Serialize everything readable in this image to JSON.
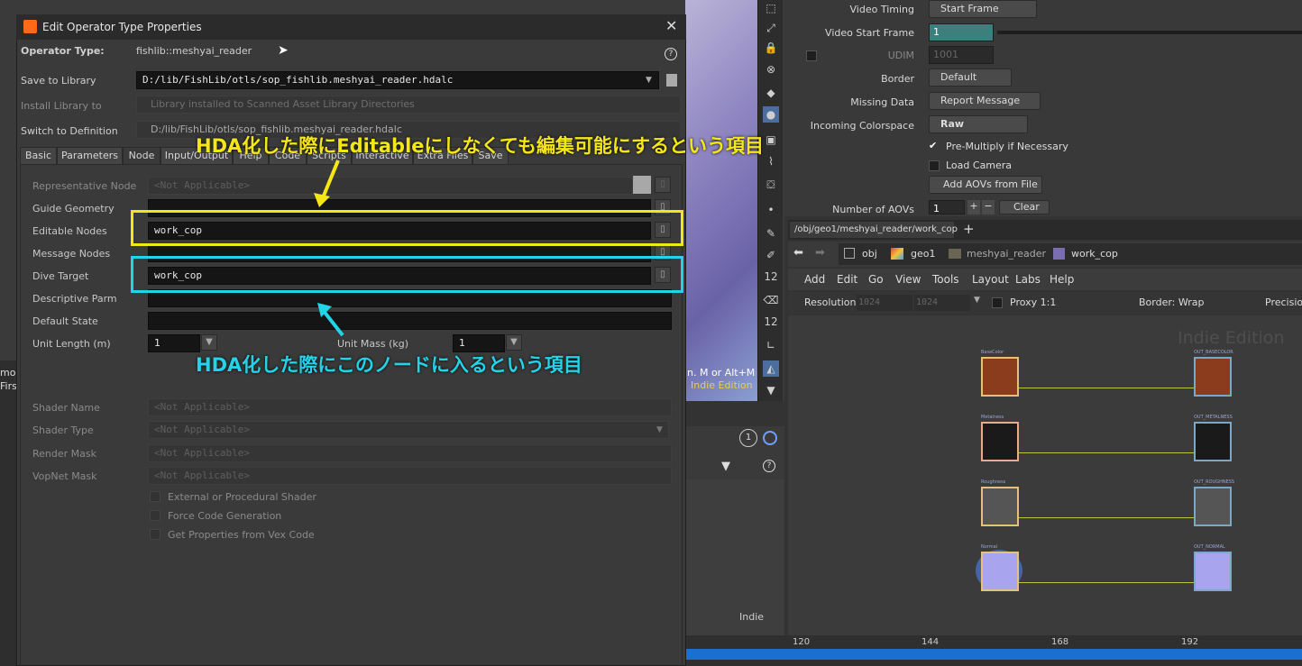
{
  "dialog": {
    "title": "Edit Operator Type Properties",
    "operator_type_label": "Operator Type:",
    "operator_type_value": "fishlib::meshyai_reader",
    "save_to_library_label": "Save to Library",
    "save_to_library_value": "D:/lib/FishLib/otls/sop_fishlib.meshyai_reader.hdalc",
    "install_library_label": "Install Library to",
    "install_library_value": "Library installed to Scanned Asset Library Directories",
    "switch_definition_label": "Switch to Definition",
    "switch_definition_value": "D:/lib/FishLib/otls/sop_fishlib.meshyai_reader.hdalc",
    "tabs": [
      "Basic",
      "Parameters",
      "Node",
      "Input/Output",
      "Help",
      "Code",
      "Scripts",
      "Interactive",
      "Extra Files",
      "Save"
    ],
    "node_tab": {
      "representative_node_label": "Representative Node",
      "representative_node_value": "<Not Applicable>",
      "guide_geometry_label": "Guide Geometry",
      "editable_nodes_label": "Editable Nodes",
      "editable_nodes_value": "work_cop",
      "message_nodes_label": "Message Nodes",
      "dive_target_label": "Dive Target",
      "dive_target_value": "work_cop",
      "descriptive_parm_label": "Descriptive Parm",
      "default_state_label": "Default State",
      "unit_length_label": "Unit Length (m)",
      "unit_length_value": "1",
      "unit_mass_label": "Unit Mass (kg)",
      "unit_mass_value": "1",
      "shader_name_label": "Shader Name",
      "shader_name_value": "<Not Applicable>",
      "shader_type_label": "Shader Type",
      "shader_type_value": "<Not Applicable>",
      "render_mask_label": "Render Mask",
      "render_mask_value": "<Not Applicable>",
      "vopnet_mask_label": "VopNet Mask",
      "vopnet_mask_value": "<Not Applicable>",
      "external_shader_label": "External or Procedural Shader",
      "force_code_label": "Force Code Generation",
      "get_properties_label": "Get Properties from Vex Code"
    }
  },
  "annotations": {
    "editable_text": "HDA化した際にEditableにしなくても編集可能にするという項目",
    "editable_color": "#f5e616",
    "dive_text": "HDA化した際にこのノードに入るという項目",
    "dive_color": "#23d3e8"
  },
  "params": {
    "video_timing_label": "Video Timing",
    "video_timing_value": "Start Frame",
    "video_start_frame_label": "Video Start Frame",
    "video_start_frame_value": "1",
    "udim_label": "UDIM",
    "udim_value": "1001",
    "border_label": "Border",
    "border_value": "Default",
    "missing_data_label": "Missing Data",
    "missing_data_value": "Report Message",
    "incoming_colorspace_label": "Incoming Colorspace",
    "incoming_colorspace_value": "Raw",
    "premultiply_label": "Pre-Multiply if Necessary",
    "load_camera_label": "Load Camera",
    "add_aovs_label": "Add AOVs from File",
    "number_of_aovs_label": "Number of AOVs",
    "number_of_aovs_value": "1",
    "clear_label": "Clear"
  },
  "network": {
    "tab_path": "/obj/geo1/meshyai_reader/work_cop",
    "breadcrumbs": [
      "obj",
      "geo1",
      "meshyai_reader",
      "work_cop"
    ],
    "menu": [
      "Add",
      "Edit",
      "Go",
      "View",
      "Tools",
      "Layout",
      "Labs",
      "Help"
    ],
    "resolution_label": "Resolution",
    "resolution_w": "1024",
    "resolution_h": "1024",
    "proxy_label": "Proxy 1:1",
    "border_label": "Border: Wrap",
    "precision_label": "Precisio",
    "watermark": "Indie Edition",
    "nodes_left": [
      "BaseColor",
      "Metalness",
      "Roughness",
      "Normal"
    ],
    "nodes_right": [
      "OUT_BASECOLOR",
      "OUT_METALNESS",
      "OUT_ROUGHNESS",
      "OUT_NORMAL"
    ]
  },
  "timeline": {
    "ticks": [
      "120",
      "144",
      "168",
      "192"
    ]
  },
  "misc": {
    "indie_label": "Indie",
    "help_hint": "n. M or Alt+M",
    "indie_edition": "Indie Edition",
    "first_text": "First",
    "mo_text": "mo",
    "frame_badge": "1"
  }
}
